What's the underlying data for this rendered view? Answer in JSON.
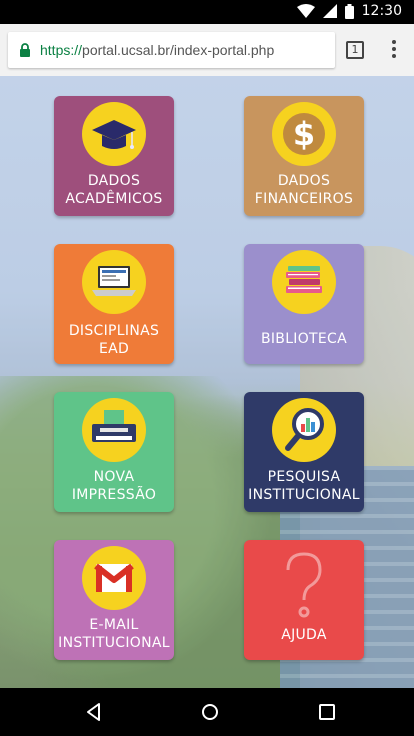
{
  "status_bar": {
    "time": "12:30"
  },
  "browser": {
    "url_scheme": "https://",
    "url_rest": "portal.ucsal.br/index-portal.php",
    "tab_count": "1"
  },
  "tiles": [
    {
      "lines": [
        "DADOS",
        "ACADÊMICOS"
      ],
      "color": "#9e4f7c",
      "icon": "graduation-cap-icon"
    },
    {
      "lines": [
        "DADOS",
        "FINANCEIROS"
      ],
      "color": "#c8955e",
      "icon": "dollar-icon"
    },
    {
      "lines": [
        "DISCIPLINAS",
        "EAD"
      ],
      "color": "#ef7b38",
      "icon": "laptop-icon"
    },
    {
      "lines": [
        "BIBLIOTECA"
      ],
      "color": "#9b8fcc",
      "icon": "books-icon"
    },
    {
      "lines": [
        "NOVA",
        "IMPRESSÃO"
      ],
      "color": "#5fc489",
      "icon": "printer-icon"
    },
    {
      "lines": [
        "PESQUISA",
        "INSTITUCIONAL"
      ],
      "color": "#2f3a68",
      "icon": "magnifier-icon"
    },
    {
      "lines": [
        "E-MAIL",
        "INSTITUCIONAL"
      ],
      "color": "#be72b6",
      "icon": "gmail-icon"
    },
    {
      "lines": [
        "AJUDA"
      ],
      "color": "#e94a4a",
      "icon": "question-icon"
    }
  ]
}
